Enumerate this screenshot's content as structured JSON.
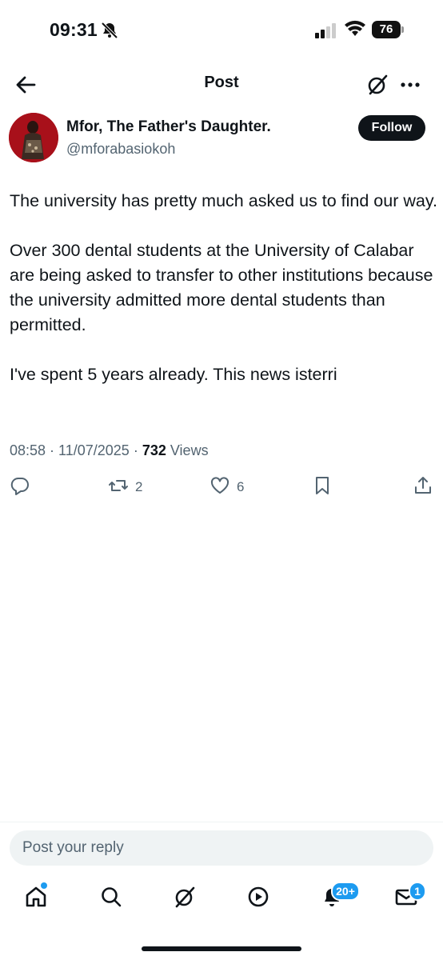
{
  "status_bar": {
    "time": "09:31",
    "battery": "76"
  },
  "header": {
    "title": "Post"
  },
  "author": {
    "name": "Mfor, The Father's Daughter.",
    "handle": "@mforabasiokoh",
    "follow_label": "Follow"
  },
  "post": {
    "paragraphs": [
      "The university has pretty much asked us to find our way.",
      "Over 300 dental students at the University of Calabar are being asked to transfer to other institutions because the university admitted more dental students than permitted.",
      "I've spent 5 years already. This news isterri"
    ],
    "time": "08:58",
    "date": "11/07/2025",
    "views_count": "732",
    "views_label": "Views"
  },
  "actions": {
    "reposts": "2",
    "likes": "6"
  },
  "reply": {
    "placeholder": "Post your reply"
  },
  "nav": {
    "notifications_badge": "20+",
    "messages_badge": "1"
  },
  "colors": {
    "accent": "#1d9bf0",
    "text": "#0f1419",
    "muted": "#536471"
  }
}
